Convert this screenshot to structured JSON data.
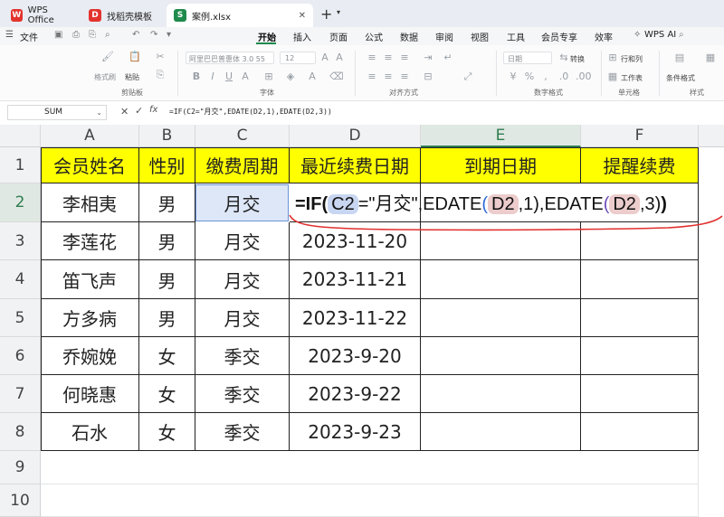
{
  "titlebar": {
    "tabs": [
      {
        "label": "WPS Office",
        "icon": "wps-logo-icon",
        "active": false
      },
      {
        "label": "找稻壳模板",
        "icon": "docer-icon",
        "active": false
      },
      {
        "label": "案例.xlsx",
        "icon": "sheet-icon",
        "active": true
      }
    ],
    "new_tab": "+"
  },
  "menubar": {
    "file": "文件",
    "items": [
      "开始",
      "插入",
      "页面",
      "公式",
      "数据",
      "审阅",
      "视图",
      "工具",
      "会员专享",
      "效率"
    ],
    "active": "开始",
    "wps_ai": "WPS AI"
  },
  "ribbon": {
    "groups": {
      "clipboard": "剪贴板",
      "font": "字体",
      "alignment": "对齐方式",
      "number": "数字格式",
      "cells": "单元格",
      "styles": "样式"
    },
    "format_painter": "格式刷",
    "paste": "粘贴",
    "font_name": "阿里巴巴普惠体 3.0 55",
    "font_size": "12",
    "number_format": "日期",
    "convert": "转换",
    "rows_cols": "行和列",
    "worksheet": "工作表",
    "cond_format": "条件格式"
  },
  "formula_bar": {
    "name_box": "SUM",
    "formula": "=IF(C2=\"月交\",EDATE(D2,1),EDATE(D2,3))"
  },
  "sheet": {
    "columns": [
      "A",
      "B",
      "C",
      "D",
      "E",
      "F"
    ],
    "selected_column": "E",
    "rows": [
      "1",
      "2",
      "3",
      "4",
      "5",
      "6",
      "7",
      "8",
      "9",
      "10"
    ],
    "header_row": [
      "会员姓名",
      "性别",
      "缴费周期",
      "最近续费日期",
      "到期日期",
      "提醒续费"
    ],
    "data": [
      [
        "李相夷",
        "男",
        "月交",
        ""
      ],
      [
        "李莲花",
        "男",
        "月交",
        "2023-11-20"
      ],
      [
        "笛飞声",
        "男",
        "月交",
        "2023-11-21"
      ],
      [
        "方多病",
        "男",
        "月交",
        "2023-11-22"
      ],
      [
        "乔婉娩",
        "女",
        "季交",
        "2023-9-20"
      ],
      [
        "何晓惠",
        "女",
        "季交",
        "2023-9-22"
      ],
      [
        "石水",
        "女",
        "季交",
        "2023-9-23"
      ]
    ],
    "editing_formula": {
      "prefix": "=IF(",
      "ref1": "C2",
      "mid1": "=\"月交\",EDATE",
      "ref2": "D2",
      "mid2": ",1),EDATE",
      "ref3": "D2",
      "tail": ",3)",
      "close": ")"
    },
    "colors": {
      "header_fill": "#ffff00",
      "accent": "#1f8a4c",
      "annotation": "#e0312f"
    }
  }
}
